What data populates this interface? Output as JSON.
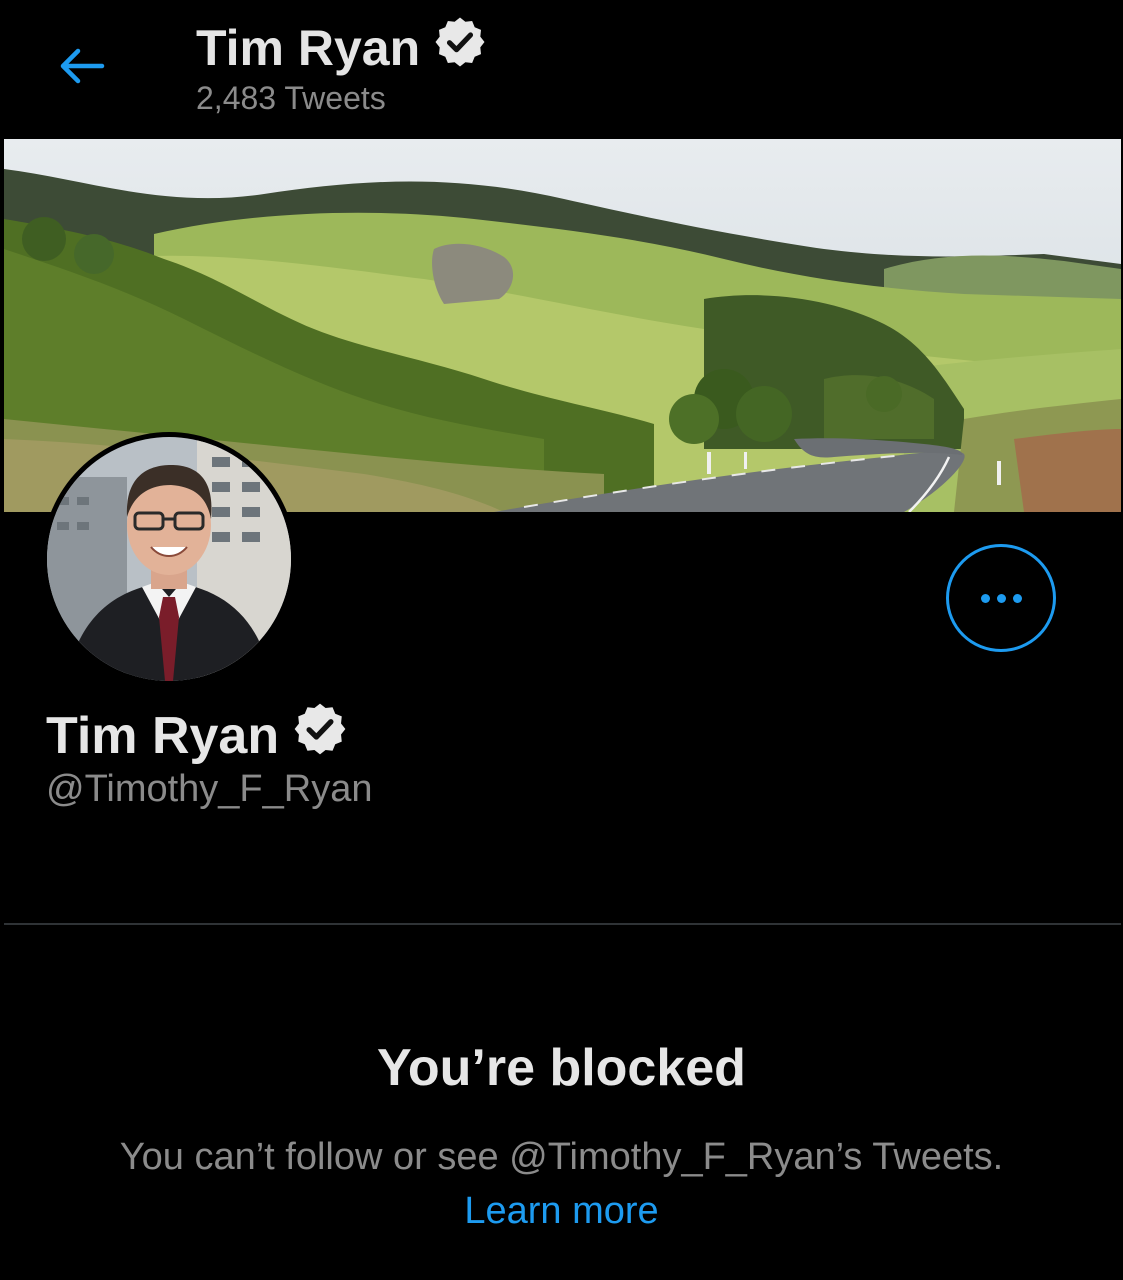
{
  "header": {
    "back_icon": "arrow-left-icon",
    "title": "Tim Ryan",
    "tweet_count": "2,483 Tweets",
    "verified_icon": "verified-badge-icon"
  },
  "profile": {
    "name": "Tim Ryan",
    "handle": "@Timothy_F_Ryan",
    "verified_icon": "verified-badge-icon",
    "more_icon": "more-horizontal-icon"
  },
  "blocked": {
    "title": "You’re blocked",
    "description": "You can’t follow or see @Timothy_F_Ryan’s Tweets.",
    "learn_more": "Learn more"
  },
  "colors": {
    "background": "#000000",
    "accent": "#1d9bf0",
    "primary_text": "#e6e6e6",
    "secondary_text": "#8b8b8b"
  }
}
